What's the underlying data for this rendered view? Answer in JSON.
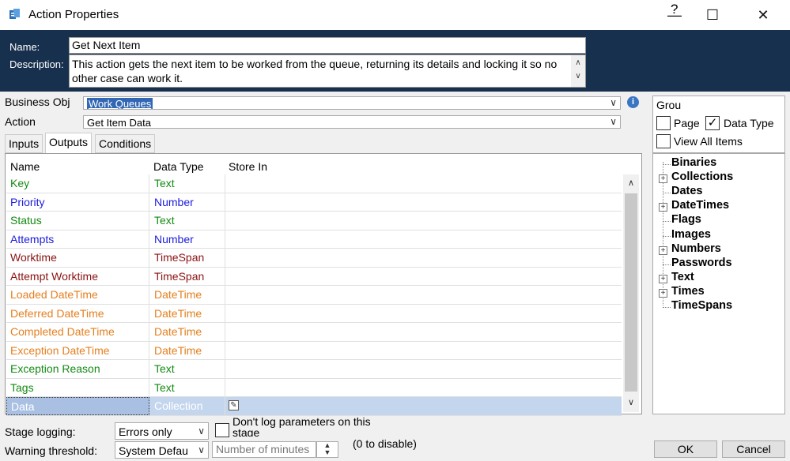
{
  "window": {
    "title": "Action Properties",
    "help": "?"
  },
  "header": {
    "name_label": "Name:",
    "name_value": "Get Next Item",
    "description_label": "Description:",
    "description_value": "This action gets the next item to be worked from the queue, returning its details and locking it so no other case can work it."
  },
  "business_obj": {
    "label": "Business Obj",
    "value": "Work Queues"
  },
  "action": {
    "label": "Action",
    "value": "Get Item Data"
  },
  "tabs": [
    {
      "label": "Inputs",
      "active": false
    },
    {
      "label": "Outputs",
      "active": true
    },
    {
      "label": "Conditions",
      "active": false
    }
  ],
  "grid": {
    "columns": [
      "Name",
      "Data Type",
      "Store In"
    ],
    "rows": [
      {
        "name": "Key",
        "type": "Text",
        "color": "#138a13"
      },
      {
        "name": "Priority",
        "type": "Number",
        "color": "#1c1cdc"
      },
      {
        "name": "Status",
        "type": "Text",
        "color": "#138a13"
      },
      {
        "name": "Attempts",
        "type": "Number",
        "color": "#1c1cdc"
      },
      {
        "name": "Worktime",
        "type": "TimeSpan",
        "color": "#8b1212"
      },
      {
        "name": "Attempt Worktime",
        "type": "TimeSpan",
        "color": "#8b1212"
      },
      {
        "name": "Loaded DateTime",
        "type": "DateTime",
        "color": "#e47f1e"
      },
      {
        "name": "Deferred DateTime",
        "type": "DateTime",
        "color": "#e47f1e"
      },
      {
        "name": "Completed DateTime",
        "type": "DateTime",
        "color": "#e47f1e"
      },
      {
        "name": "Exception DateTime",
        "type": "DateTime",
        "color": "#e47f1e"
      },
      {
        "name": "Exception Reason",
        "type": "Text",
        "color": "#138a13"
      },
      {
        "name": "Tags",
        "type": "Text",
        "color": "#138a13"
      },
      {
        "name": "Data",
        "type": "Collection",
        "color": "#ffffff"
      }
    ]
  },
  "right_panel": {
    "group_label": "Grou",
    "page_label": "Page",
    "page_checked": false,
    "data_type_label": "Data Type",
    "data_type_checked": true,
    "view_all_label": "View All Items",
    "view_all_checked": false
  },
  "tree": [
    {
      "label": "Binaries",
      "expandable": false
    },
    {
      "label": "Collections",
      "expandable": true
    },
    {
      "label": "Dates",
      "expandable": false
    },
    {
      "label": "DateTimes",
      "expandable": true
    },
    {
      "label": "Flags",
      "expandable": false
    },
    {
      "label": "Images",
      "expandable": false
    },
    {
      "label": "Numbers",
      "expandable": true
    },
    {
      "label": "Passwords",
      "expandable": false
    },
    {
      "label": "Text",
      "expandable": true
    },
    {
      "label": "Times",
      "expandable": true
    },
    {
      "label": "TimeSpans",
      "expandable": false
    }
  ],
  "bottom": {
    "stage_logging_label": "Stage logging:",
    "stage_logging_value": "Errors only",
    "dont_log_label": "Don't log parameters on this stage",
    "warning_label": "Warning threshold:",
    "warning_value": "System Defau",
    "minutes_placeholder": "Number of minutes",
    "zero_hint": "(0 to disable)",
    "ok_label": "OK",
    "cancel_label": "Cancel"
  }
}
